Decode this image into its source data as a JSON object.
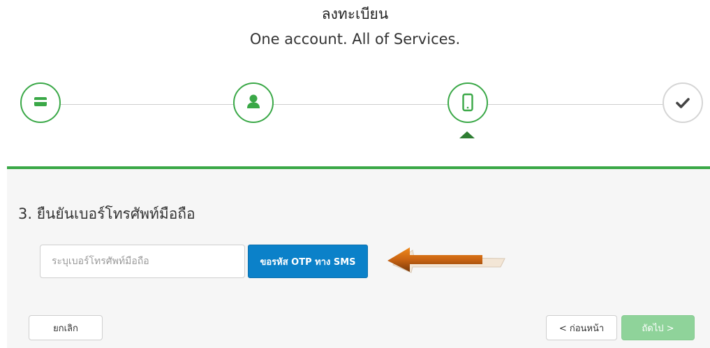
{
  "header": {
    "title": "ลงทะเบียน",
    "subtitle": "One account. All of Services."
  },
  "stepper": {
    "steps": [
      {
        "icon": "credit-card-icon",
        "state": "completed"
      },
      {
        "icon": "user-icon",
        "state": "completed"
      },
      {
        "icon": "mobile-phone-icon",
        "state": "current"
      },
      {
        "icon": "checkmark-icon",
        "state": "pending"
      }
    ],
    "accent_color": "#3aa847",
    "pending_color": "#d5d5d5"
  },
  "form": {
    "section_title": "3. ยืนยันเบอร์โทรศัพท์มือถือ",
    "phone_input": {
      "placeholder": "ระบุเบอร์โทรศัพท์มือถือ",
      "value": ""
    },
    "otp_button_label": "ขอรหัส OTP ทาง SMS",
    "otp_button_color": "#0b81c9"
  },
  "footer": {
    "cancel_label": "ยกเลิก",
    "prev_label": "< ก่อนหน้า",
    "next_label": "ถัดไป >",
    "next_color": "#8fd39a"
  }
}
